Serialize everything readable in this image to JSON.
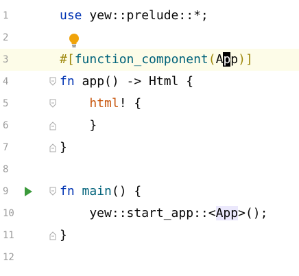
{
  "editor": {
    "lines": [
      {
        "number": "1",
        "tokens": [
          {
            "t": "use",
            "c": "kw"
          },
          {
            "t": " yew::prelude::*;",
            "c": ""
          }
        ]
      },
      {
        "number": "2",
        "tokens": []
      },
      {
        "number": "3",
        "tokens": [
          {
            "t": "#[",
            "c": "attr"
          },
          {
            "t": "function_component",
            "c": "fnname"
          },
          {
            "t": "(",
            "c": "attr"
          },
          {
            "t": "A",
            "c": ""
          },
          {
            "t": "p",
            "c": "caret-char"
          },
          {
            "t": "p",
            "c": ""
          },
          {
            "t": ")]",
            "c": "attr"
          }
        ]
      },
      {
        "number": "4",
        "tokens": [
          {
            "t": "fn",
            "c": "kw"
          },
          {
            "t": " app() -> Html {",
            "c": ""
          }
        ]
      },
      {
        "number": "5",
        "tokens": [
          {
            "t": "    ",
            "c": ""
          },
          {
            "t": "html",
            "c": "macro"
          },
          {
            "t": "! {",
            "c": ""
          }
        ]
      },
      {
        "number": "6",
        "tokens": [
          {
            "t": "    }",
            "c": ""
          }
        ]
      },
      {
        "number": "7",
        "tokens": [
          {
            "t": "}",
            "c": ""
          }
        ]
      },
      {
        "number": "8",
        "tokens": []
      },
      {
        "number": "9",
        "tokens": [
          {
            "t": "fn",
            "c": "kw"
          },
          {
            "t": " ",
            "c": ""
          },
          {
            "t": "main",
            "c": "fnname"
          },
          {
            "t": "() {",
            "c": ""
          }
        ]
      },
      {
        "number": "10",
        "tokens": [
          {
            "t": "    yew::start_app::<",
            "c": ""
          },
          {
            "t": "App",
            "c": "typehl"
          },
          {
            "t": ">();",
            "c": ""
          }
        ]
      },
      {
        "number": "11",
        "tokens": [
          {
            "t": "}",
            "c": ""
          }
        ]
      },
      {
        "number": "12",
        "tokens": []
      }
    ],
    "current_line": 3,
    "run_line": 9,
    "fold_markers": {
      "open": [
        4,
        5,
        9
      ],
      "close": [
        6,
        7,
        11
      ]
    },
    "intention_bulb_line": 2,
    "colors": {
      "keyword": "#0033b3",
      "attribute": "#9e880d",
      "function": "#00627a",
      "macro": "#c7540a",
      "run": "#3b9a3b",
      "bulb": "#f0a30a"
    }
  }
}
